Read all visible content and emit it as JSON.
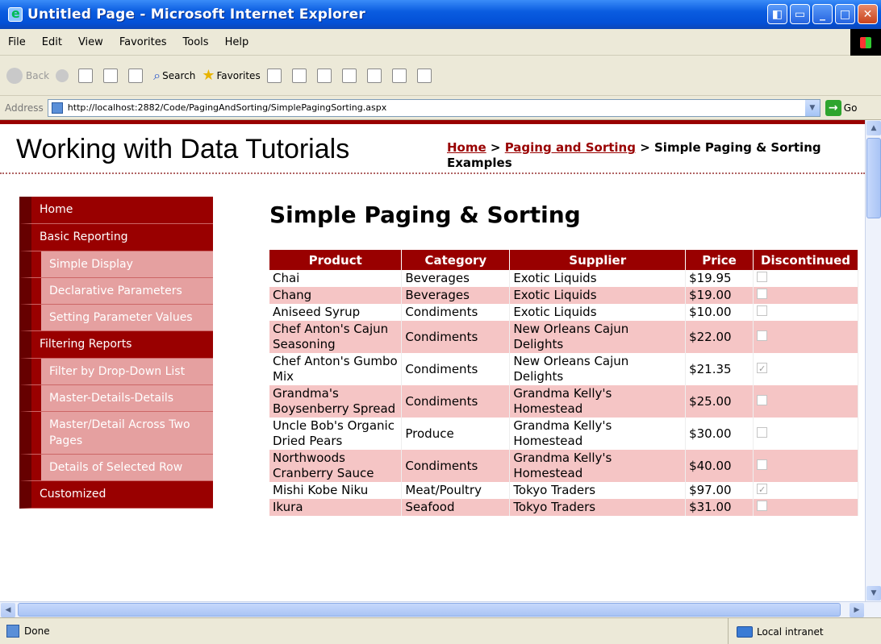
{
  "window": {
    "title": "Untitled Page - Microsoft Internet Explorer",
    "buttons": [
      "◧",
      "▭",
      "_",
      "□",
      "✕"
    ]
  },
  "menu": [
    "File",
    "Edit",
    "View",
    "Favorites",
    "Tools",
    "Help"
  ],
  "toolbar": {
    "back": "Back",
    "search": "Search",
    "favorites": "Favorites"
  },
  "address": {
    "label": "Address",
    "url": "http://localhost:2882/Code/PagingAndSorting/SimplePagingSorting.aspx",
    "go": "Go"
  },
  "status": {
    "text": "Done",
    "zone": "Local intranet"
  },
  "page": {
    "site_title": "Working with Data Tutorials",
    "breadcrumb": {
      "home": "Home",
      "sep1": ">",
      "section": "Paging and Sorting",
      "sep2": ">",
      "current": "Simple Paging & Sorting Examples"
    },
    "title": "Simple Paging & Sorting"
  },
  "nav": {
    "home": "Home",
    "basic": "Basic Reporting",
    "basic_items": [
      "Simple Display",
      "Declarative Parameters",
      "Setting Parameter Values"
    ],
    "filtering": "Filtering Reports",
    "filtering_items": [
      "Filter by Drop-Down List",
      "Master-Details-Details",
      "Master/Detail Across Two Pages",
      "Details of Selected Row"
    ],
    "next": "Customized"
  },
  "grid": {
    "headers": [
      "Product",
      "Category",
      "Supplier",
      "Price",
      "Discontinued"
    ],
    "rows": [
      {
        "product": "Chai",
        "category": "Beverages",
        "supplier": "Exotic Liquids",
        "price": "$19.95",
        "discontinued": false
      },
      {
        "product": "Chang",
        "category": "Beverages",
        "supplier": "Exotic Liquids",
        "price": "$19.00",
        "discontinued": false
      },
      {
        "product": "Aniseed Syrup",
        "category": "Condiments",
        "supplier": "Exotic Liquids",
        "price": "$10.00",
        "discontinued": false
      },
      {
        "product": "Chef Anton's Cajun Seasoning",
        "category": "Condiments",
        "supplier": "New Orleans Cajun Delights",
        "price": "$22.00",
        "discontinued": false
      },
      {
        "product": "Chef Anton's Gumbo Mix",
        "category": "Condiments",
        "supplier": "New Orleans Cajun Delights",
        "price": "$21.35",
        "discontinued": true
      },
      {
        "product": "Grandma's Boysenberry Spread",
        "category": "Condiments",
        "supplier": "Grandma Kelly's Homestead",
        "price": "$25.00",
        "discontinued": false
      },
      {
        "product": "Uncle Bob's Organic Dried Pears",
        "category": "Produce",
        "supplier": "Grandma Kelly's Homestead",
        "price": "$30.00",
        "discontinued": false
      },
      {
        "product": "Northwoods Cranberry Sauce",
        "category": "Condiments",
        "supplier": "Grandma Kelly's Homestead",
        "price": "$40.00",
        "discontinued": false
      },
      {
        "product": "Mishi Kobe Niku",
        "category": "Meat/Poultry",
        "supplier": "Tokyo Traders",
        "price": "$97.00",
        "discontinued": true
      },
      {
        "product": "Ikura",
        "category": "Seafood",
        "supplier": "Tokyo Traders",
        "price": "$31.00",
        "discontinued": false
      }
    ]
  }
}
